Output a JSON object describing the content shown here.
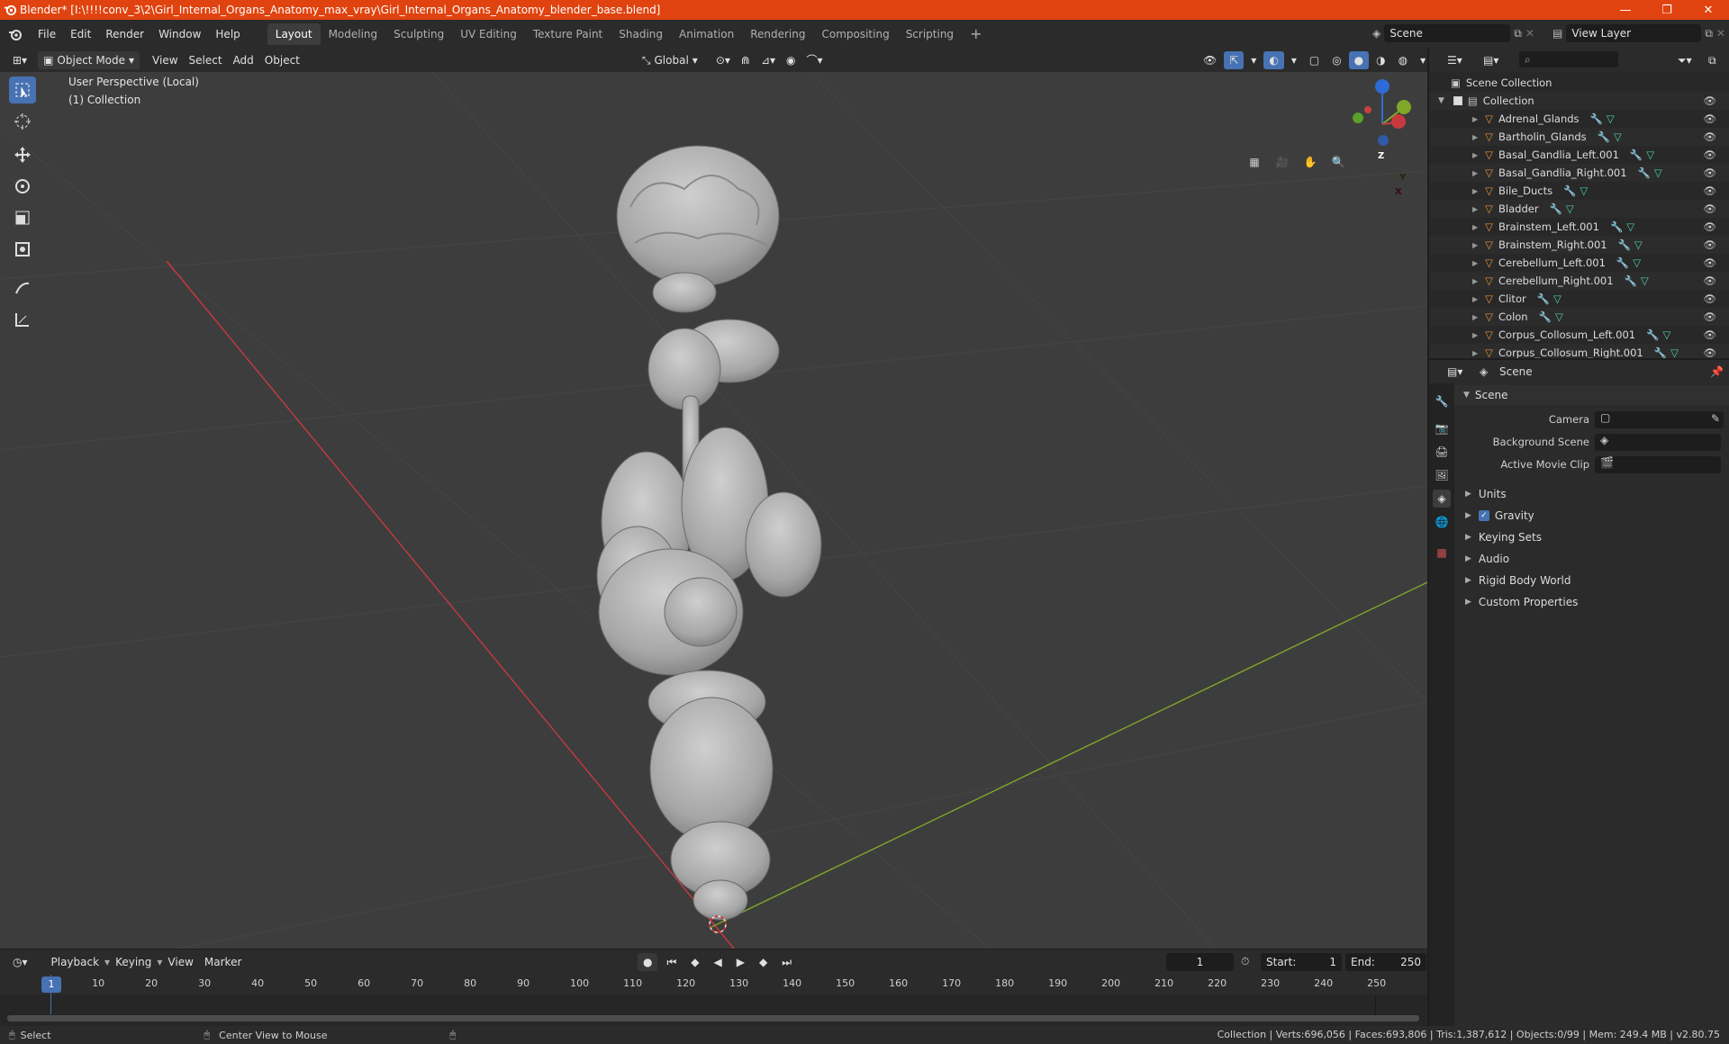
{
  "window": {
    "title": "Blender* [I:\\!!!!conv_3\\2\\Girl_Internal_Organs_Anatomy_max_vray\\Girl_Internal_Organs_Anatomy_blender_base.blend]",
    "minimize": "—",
    "maximize": "❐",
    "close": "✕"
  },
  "menu": {
    "items": [
      "File",
      "Edit",
      "Render",
      "Window",
      "Help"
    ],
    "workspaces": [
      "Layout",
      "Modeling",
      "Sculpting",
      "UV Editing",
      "Texture Paint",
      "Shading",
      "Animation",
      "Rendering",
      "Compositing",
      "Scripting"
    ],
    "active_workspace": "Layout",
    "add_tab": "+",
    "scene_name": "Scene",
    "view_layer": "View Layer"
  },
  "viewport_header": {
    "mode": "Object Mode",
    "menus": [
      "View",
      "Select",
      "Add",
      "Object"
    ],
    "transform_orientation": "Global"
  },
  "viewport": {
    "perspective_label": "User Perspective (Local)",
    "collection_label": "(1) Collection",
    "gizmo": {
      "x": "X",
      "y": "Y",
      "z": "Z"
    }
  },
  "outliner": {
    "root": "Scene Collection",
    "collection": "Collection",
    "objects": [
      "Adrenal_Glands",
      "Bartholin_Glands",
      "Basal_Gandlia_Left.001",
      "Basal_Gandlia_Right.001",
      "Bile_Ducts",
      "Bladder",
      "Brainstem_Left.001",
      "Brainstem_Right.001",
      "Cerebellum_Left.001",
      "Cerebellum_Right.001",
      "Clitor",
      "Colon",
      "Corpus_Collosum_Left.001",
      "Corpus_Collosum_Right.001"
    ]
  },
  "properties": {
    "header": "Scene",
    "panel_title": "Scene",
    "fields": [
      {
        "label": "Camera"
      },
      {
        "label": "Background Scene"
      },
      {
        "label": "Active Movie Clip"
      }
    ],
    "subpanels": [
      "Units",
      "Gravity",
      "Keying Sets",
      "Audio",
      "Rigid Body World",
      "Custom Properties"
    ],
    "gravity_checked": true
  },
  "timeline": {
    "menus": [
      "Playback",
      "Keying",
      "View",
      "Marker"
    ],
    "current_frame": "1",
    "start_label": "Start:",
    "start": "1",
    "end_label": "End:",
    "end": "250",
    "ruler": [
      "10",
      "20",
      "30",
      "40",
      "50",
      "60",
      "70",
      "80",
      "90",
      "100",
      "110",
      "120",
      "130",
      "140",
      "150",
      "160",
      "170",
      "180",
      "190",
      "200",
      "210",
      "220",
      "230",
      "240",
      "250"
    ],
    "playhead": "1"
  },
  "status": {
    "select": "Select",
    "center_view": "Center View to Mouse",
    "stats": "Collection | Verts:696,056 | Faces:693,806 | Tris:1,387,612 | Objects:0/99 | Mem: 249.4 MB | v2.80.75"
  },
  "colors": {
    "title_bar": "#e0430f",
    "active_blue": "#4772b3",
    "mesh_orange": "#e8913a",
    "modifier_blue": "#6fa8ff",
    "mesh_data_green": "#4fd1a8",
    "axis_red": "#c8393f",
    "axis_green": "#7fa72a"
  }
}
